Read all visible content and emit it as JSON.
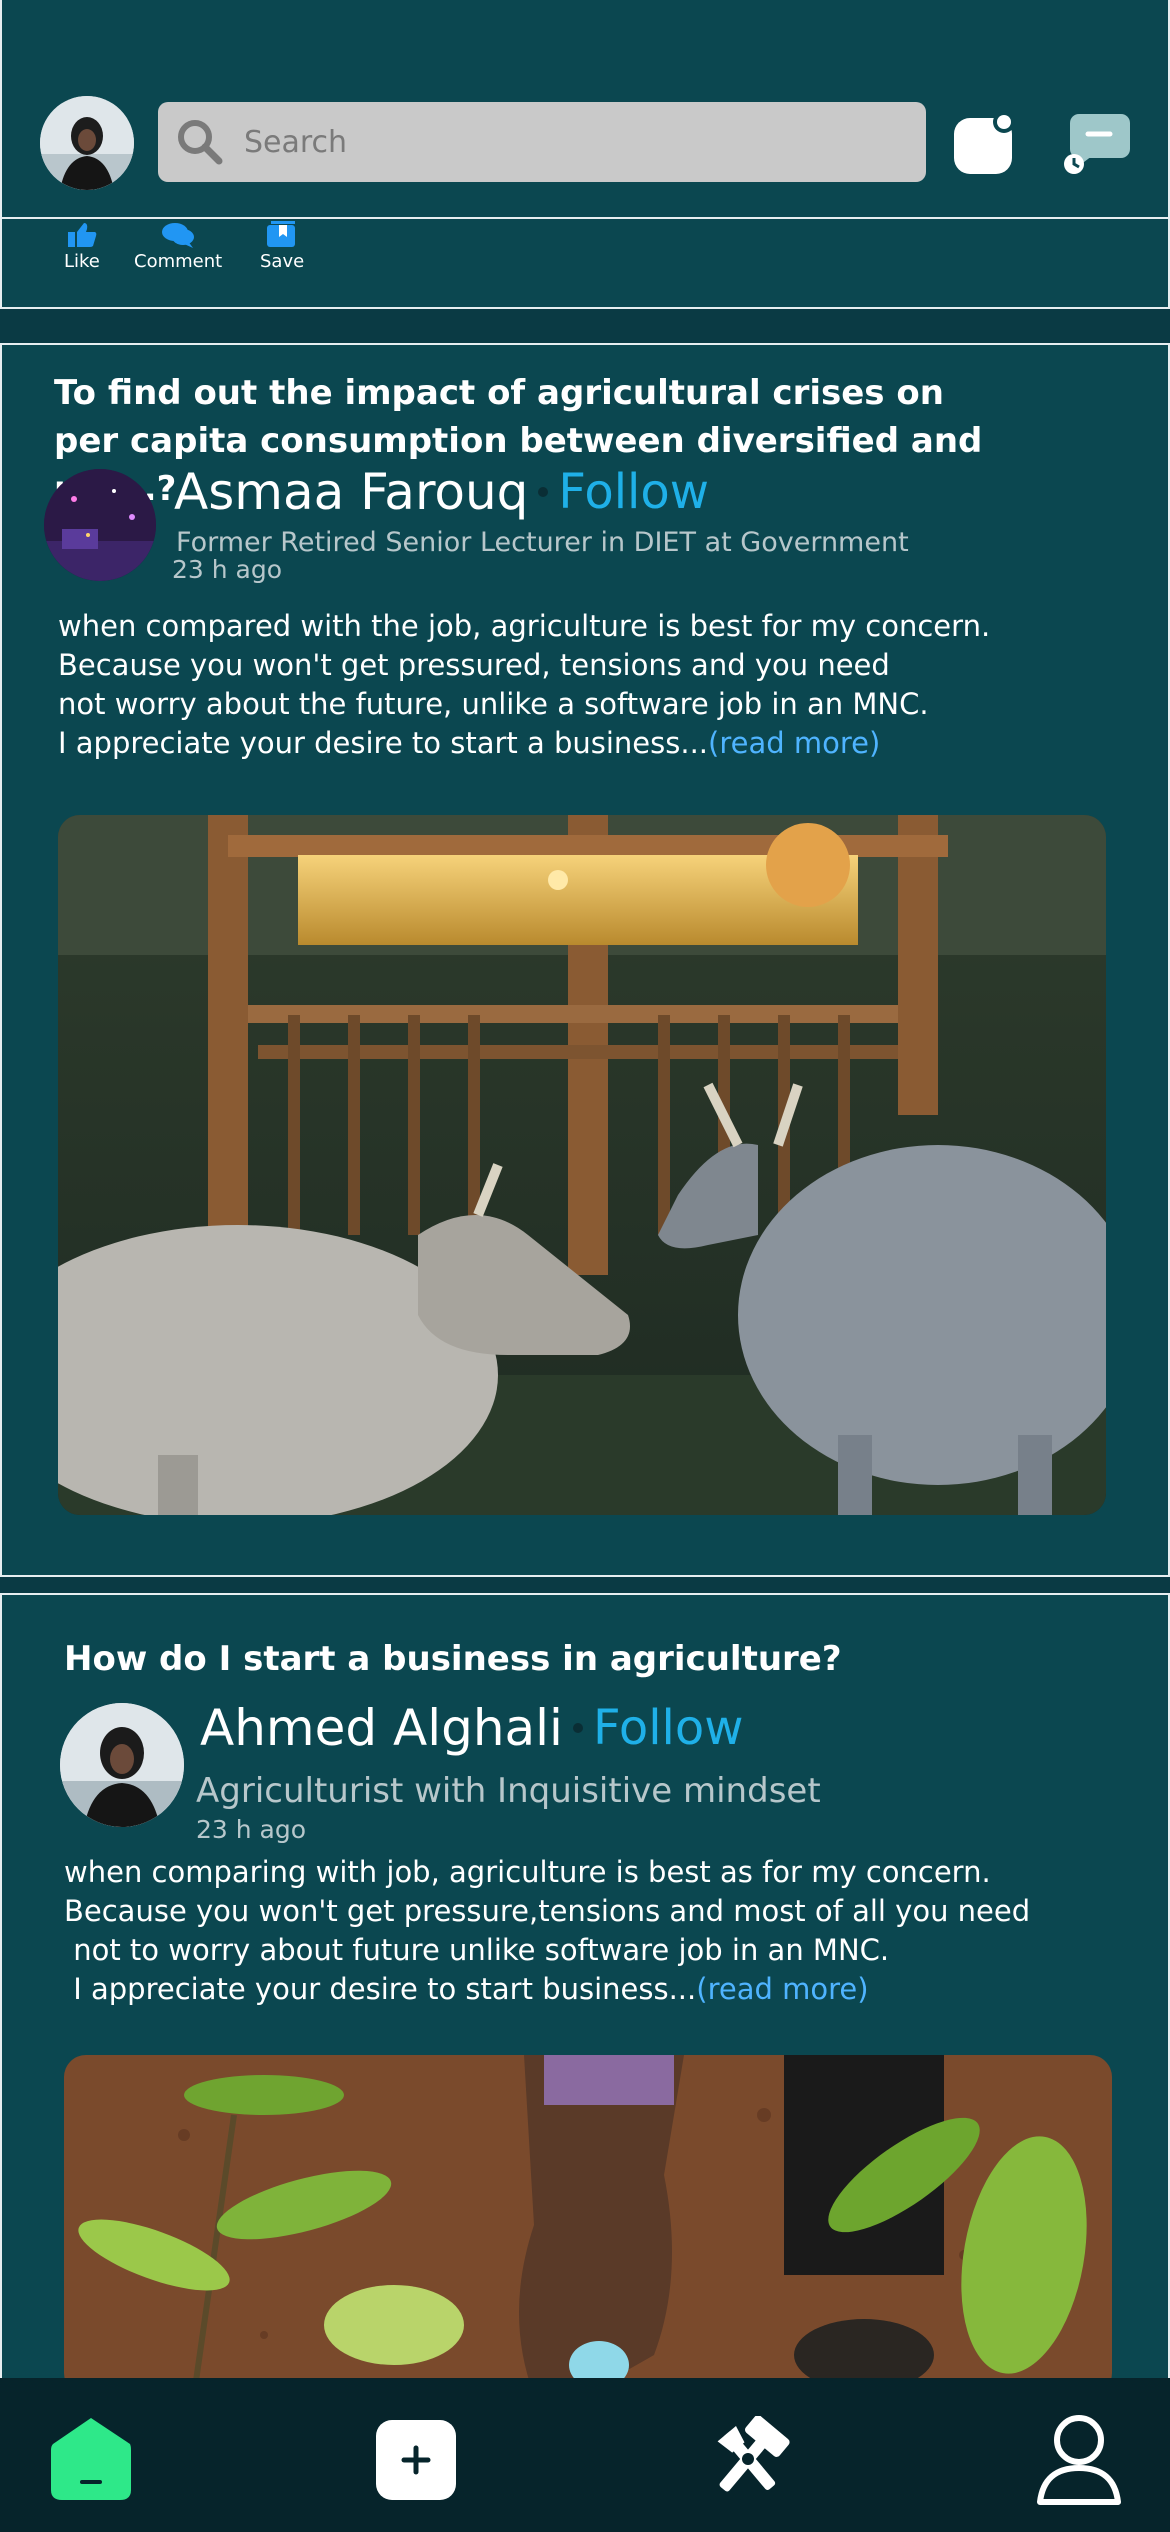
{
  "header": {
    "search": {
      "placeholder": "Search"
    }
  },
  "actions": {
    "like": "Like",
    "comment": "Comment",
    "save": "Save"
  },
  "posts": [
    {
      "question": "To find out the impact of agricultural crises on per capita consumption between diversified and not...?",
      "author": "Asmaa Farouq",
      "follow": "Follow",
      "subtitle": "Former Retired Senior Lecturer in DIET at Government",
      "time": "23 h ago",
      "body": "when compared with the job, agriculture is best for my concern.\nBecause you won't get pressured, tensions and you need\nnot worry about the future, unlike a software job in an MNC.\nI appreciate your desire to start a business...",
      "read_more": "(read more)"
    },
    {
      "question": "How do I start a business in agriculture?",
      "author": "Ahmed Alghali",
      "follow": "Follow",
      "subtitle": "Agriculturist with Inquisitive mindset",
      "time": "23 h ago",
      "body": "when comparing with job, agriculture is best as for my concern.\nBecause you won't get pressure,tensions and most of all you need\n not to worry about future unlike software job in an MNC.\n I appreciate your desire to start business...",
      "read_more": "(read more)"
    }
  ],
  "colors": {
    "background": "#0b4750",
    "link": "#1fb0e8",
    "home_active": "#2ee889"
  },
  "nav": {
    "icons": [
      "home-icon",
      "add-post-icon",
      "tools-icon",
      "profile-icon"
    ]
  }
}
